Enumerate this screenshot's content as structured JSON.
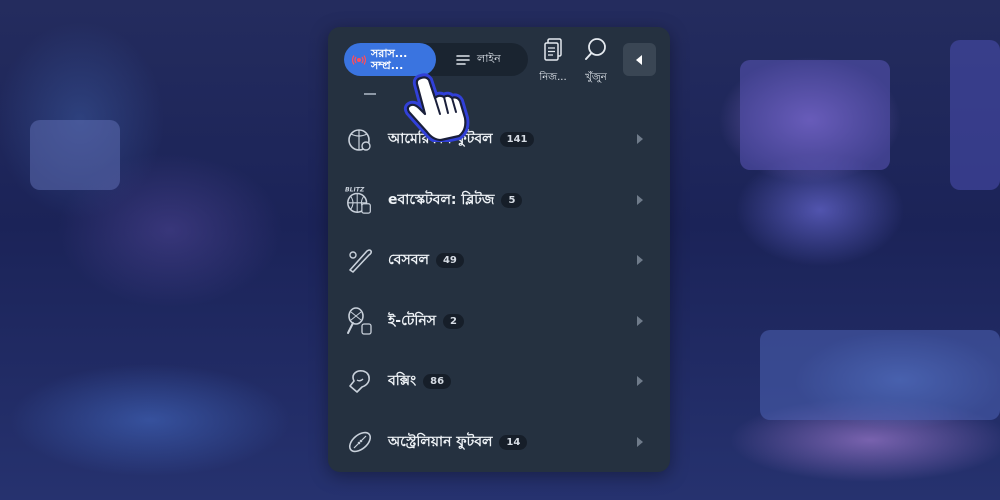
{
  "topbar": {
    "live_label": "সরাস...\nসম্প্র...",
    "line_label": "লাইন",
    "favorites_label": "নিজ...",
    "search_label": "খুঁজুন"
  },
  "sports": [
    {
      "name": "আমেরিকান ফুটবল",
      "count": "141",
      "icon": "american-football-icon"
    },
    {
      "name": "eবাস্কেটবল: ব্লিটজ",
      "count": "5",
      "icon": "ebasketball-blitz-icon",
      "icon_text": "BLITZ"
    },
    {
      "name": "বেসবল",
      "count": "49",
      "icon": "baseball-bat-icon"
    },
    {
      "name": "ই-টেনিস",
      "count": "2",
      "icon": "etennis-icon"
    },
    {
      "name": "বক্সিং",
      "count": "86",
      "icon": "boxing-glove-icon"
    },
    {
      "name": "অস্ট্রেলিয়ান ফুটবল",
      "count": "14",
      "icon": "australian-football-icon"
    }
  ],
  "colors": {
    "panel_bg": "#253140",
    "live_accent": "#3a74e0",
    "badge_bg": "#161e29",
    "live_dot": "#ff4d5a"
  }
}
